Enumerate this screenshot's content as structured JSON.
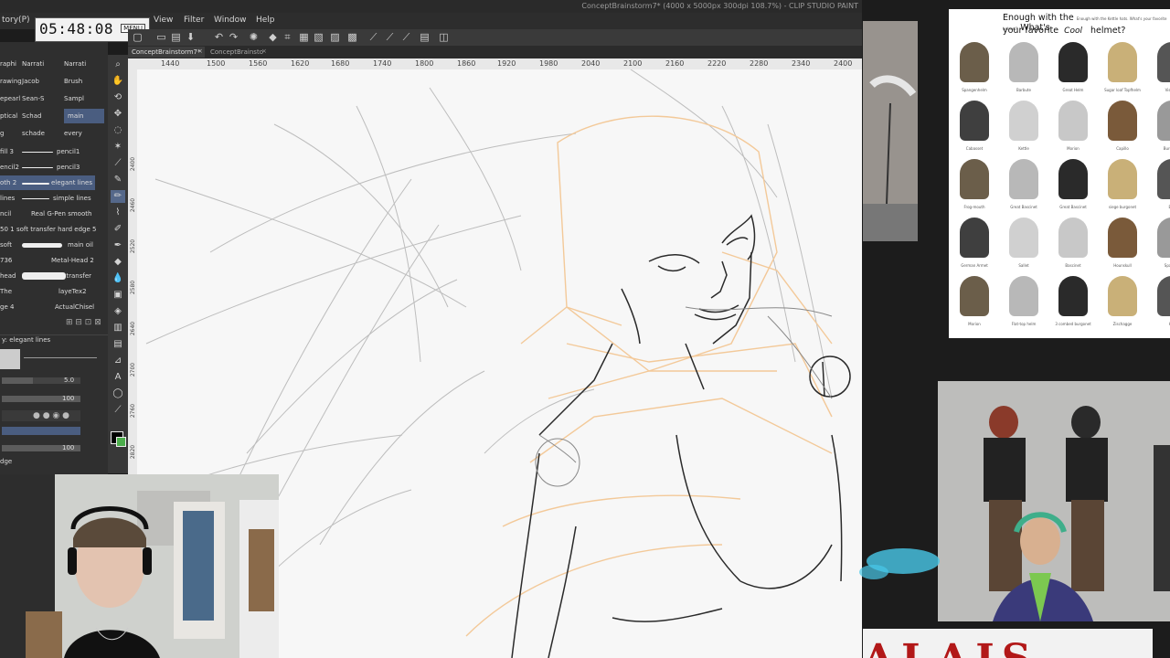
{
  "app": {
    "title": "ConceptBrainstorm7* (4000 x 5000px 300dpi 108.7%) - CLIP STUDIO PAINT",
    "menu": [
      "View",
      "Filter",
      "Window",
      "Help"
    ],
    "left_label": "tory(P)"
  },
  "clock": {
    "time": "05:48:08",
    "menu_label": "MENU"
  },
  "tabs": [
    {
      "label": "ConceptBrainstorm7*"
    },
    {
      "label": "ConceptBrainsto"
    }
  ],
  "ruler": {
    "ticks": [
      "1440",
      "1500",
      "1560",
      "1620",
      "1680",
      "1740",
      "1800",
      "1860",
      "1920",
      "1980",
      "2040",
      "2100",
      "2160",
      "2220",
      "2280",
      "2340",
      "2400"
    ],
    "vticks": [
      "2400",
      "2460",
      "2520",
      "2580",
      "2640",
      "2700",
      "2760",
      "2820",
      "2880"
    ]
  },
  "subtools": [
    {
      "label": "raphi",
      "sel": false
    },
    {
      "label": "Narrati",
      "sel": false
    },
    {
      "label": "Narrati",
      "sel": false
    },
    {
      "label": "rawing",
      "sel": false
    },
    {
      "label": "Jacob",
      "sel": false
    },
    {
      "label": "Brush",
      "sel": false
    },
    {
      "label": "epearl",
      "sel": false
    },
    {
      "label": "Sean-S",
      "sel": false
    },
    {
      "label": "Sampl",
      "sel": false
    },
    {
      "label": "ptical",
      "sel": false
    },
    {
      "label": "Schad",
      "sel": false
    },
    {
      "label": "main",
      "sel": true
    },
    {
      "label": "g",
      "sel": false
    },
    {
      "label": "schade",
      "sel": false
    },
    {
      "label": "every",
      "sel": false
    }
  ],
  "brushes": [
    {
      "label": "fill 3",
      "name": "pencil1",
      "sel": false
    },
    {
      "label": "encil2",
      "name": "pencil3",
      "sel": false
    },
    {
      "label": "oth 2",
      "name": "elegant lines",
      "sel": true
    },
    {
      "label": "lines",
      "name": "simple lines",
      "sel": false
    },
    {
      "label": "ncil",
      "name": "Real G-Pen smooth",
      "sel": false
    },
    {
      "label": "50 1",
      "name": "soft transfer hard edge 5",
      "sel": false
    },
    {
      "label": "soft",
      "name": "main oil",
      "sel": false
    },
    {
      "label": "736",
      "name": "Metal-Head 2",
      "sel": false
    },
    {
      "label": "head",
      "name": "oil transfer",
      "sel": false
    },
    {
      "label": "The",
      "name": "layeTex2",
      "sel": false
    },
    {
      "label": "ge 4",
      "name": "ActualChisel",
      "sel": false
    }
  ],
  "properties": {
    "brush_name": "y: elegant lines",
    "size": "5.0",
    "opacity": "100",
    "density": "100",
    "edge_label": "dge"
  },
  "tools": [
    "magnifier",
    "hand",
    "rotate",
    "move",
    "lasso",
    "wand",
    "eyedropper",
    "pen",
    "pencil",
    "brush",
    "airbrush",
    "decoration",
    "eraser",
    "blend",
    "fill",
    "gradient",
    "figure",
    "frame",
    "ruler",
    "text",
    "balloon",
    "line",
    "color"
  ],
  "references": {
    "helmets": {
      "question_line1": "Enough with the",
      "question_tail1": "What's",
      "question_line2": "your favorite",
      "accent": "Cool",
      "question_tail2": "helmet?",
      "fine_print": "Enough with the Kettle hats. What's your favorite helmet?",
      "items": [
        "Spangenhelm",
        "Barbute",
        "Great Helm",
        "Sugar loaf Topfhelm",
        "Visored",
        "Cabasset",
        "Kettle",
        "Morion",
        "Capillo",
        "Burgonet",
        "Frog-mouth",
        "Great Bascinet",
        "Great Bascinet",
        "siege burgonet",
        "Bur",
        "German Armet",
        "Sallet",
        "Bascinet",
        "Hounskull",
        "Sparrow",
        "Morion",
        "Flat-top helm",
        "3 combed burgonet",
        "Zischagge",
        "Hel"
      ]
    },
    "banner_text": "ALAIS"
  }
}
